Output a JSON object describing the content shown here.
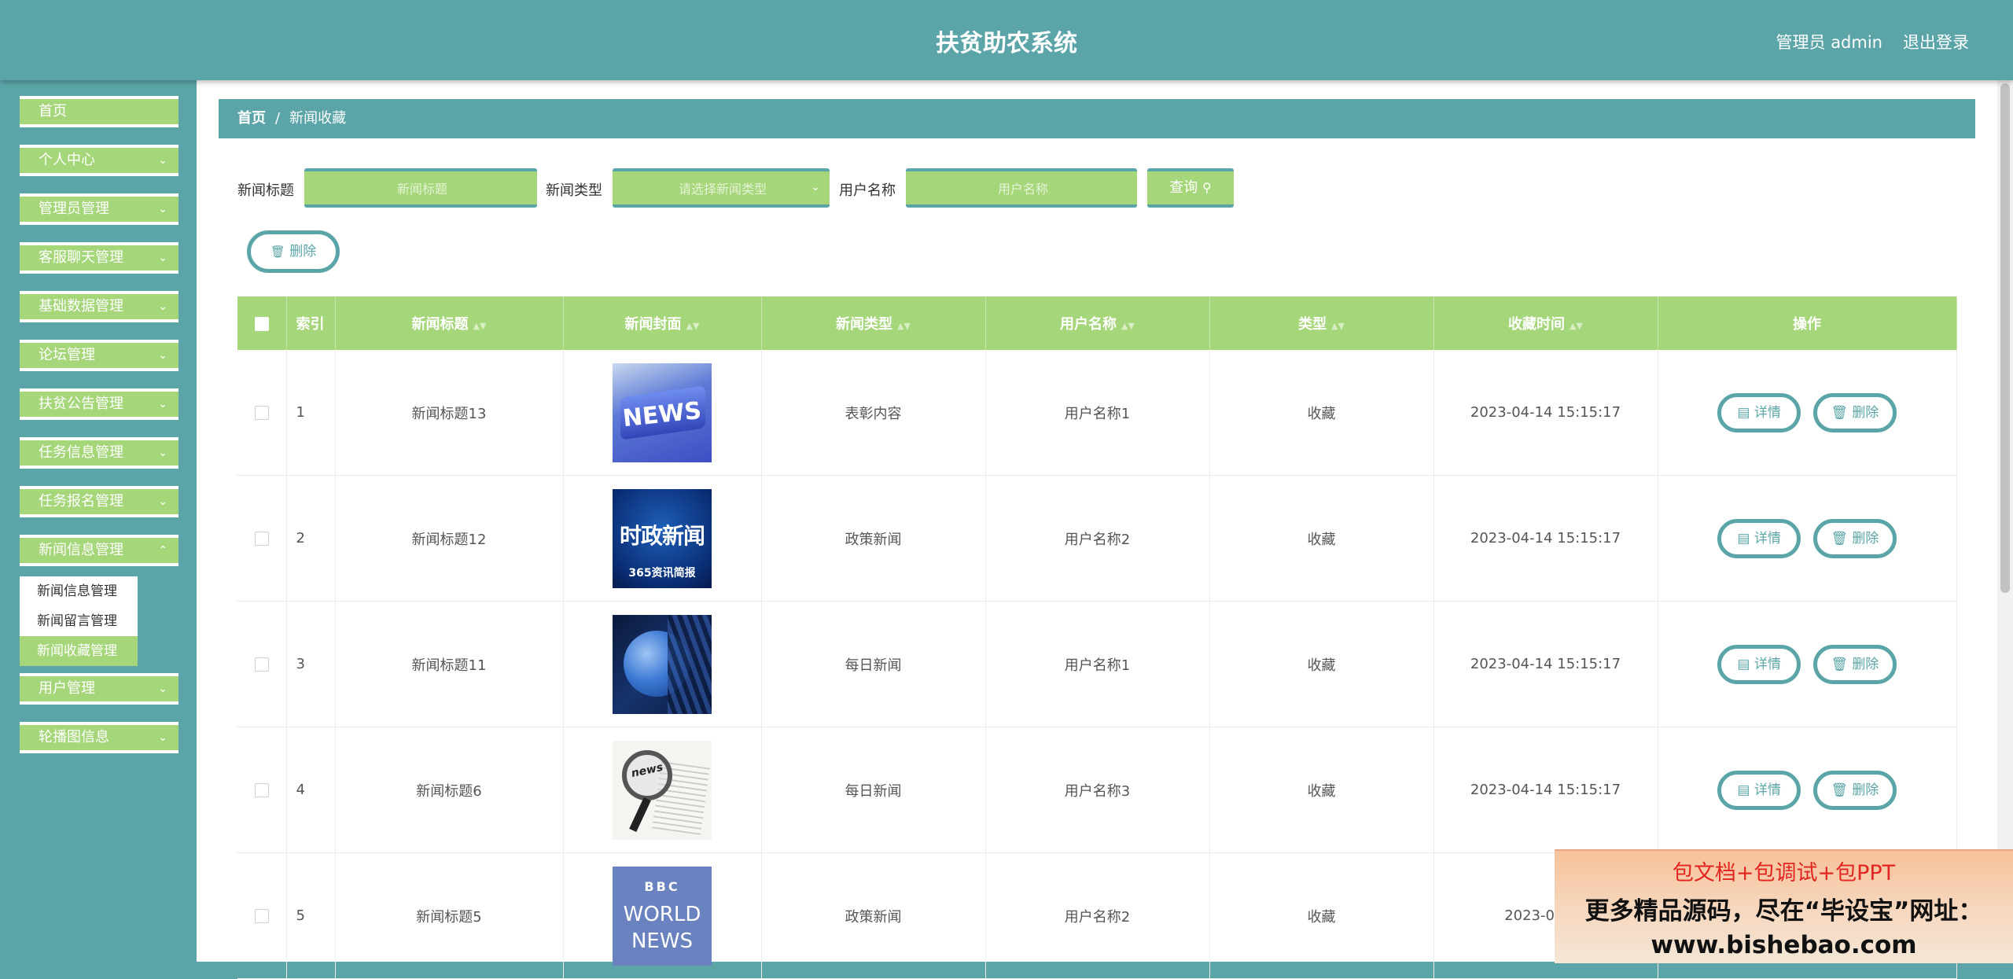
{
  "header": {
    "title": "扶贫助农系统",
    "user": "管理员 admin",
    "logout": "退出登录"
  },
  "sidebar": {
    "items": [
      {
        "label": "首页"
      },
      {
        "label": "个人中心"
      },
      {
        "label": "管理员管理"
      },
      {
        "label": "客服聊天管理"
      },
      {
        "label": "基础数据管理"
      },
      {
        "label": "论坛管理"
      },
      {
        "label": "扶贫公告管理"
      },
      {
        "label": "任务信息管理"
      },
      {
        "label": "任务报名管理"
      },
      {
        "label": "新闻信息管理"
      },
      {
        "label": "用户管理"
      },
      {
        "label": "轮播图信息"
      }
    ],
    "submenu": [
      "新闻信息管理",
      "新闻留言管理",
      "新闻收藏管理"
    ]
  },
  "breadcrumb": {
    "home": "首页",
    "separator": "/",
    "current": "新闻收藏"
  },
  "search": {
    "title_label": "新闻标题",
    "title_placeholder": "新闻标题",
    "type_label": "新闻类型",
    "type_placeholder": "请选择新闻类型",
    "user_label": "用户名称",
    "user_placeholder": "用户名称",
    "query_button": "查询"
  },
  "actions": {
    "delete_button": "删除"
  },
  "table": {
    "headers": [
      "索引",
      "新闻标题",
      "新闻封面",
      "新闻类型",
      "用户名称",
      "类型",
      "收藏时间",
      "操作"
    ],
    "detail_label": "详情",
    "delete_label": "删除",
    "rows": [
      {
        "index": "1",
        "title": "新闻标题13",
        "cover": "NEWS",
        "news_type": "表彰内容",
        "user": "用户名称1",
        "kind": "收藏",
        "time": "2023-04-14 15:15:17"
      },
      {
        "index": "2",
        "title": "新闻标题12",
        "cover": "时政新闻",
        "news_type": "政策新闻",
        "user": "用户名称2",
        "kind": "收藏",
        "time": "2023-04-14 15:15:17"
      },
      {
        "index": "3",
        "title": "新闻标题11",
        "cover": "",
        "news_type": "每日新闻",
        "user": "用户名称1",
        "kind": "收藏",
        "time": "2023-04-14 15:15:17"
      },
      {
        "index": "4",
        "title": "新闻标题6",
        "cover": "news",
        "news_type": "每日新闻",
        "user": "用户名称3",
        "kind": "收藏",
        "time": "2023-04-14 15:15:17"
      },
      {
        "index": "5",
        "title": "新闻标题5",
        "cover": "BBC WORLD NEWS",
        "news_type": "政策新闻",
        "user": "用户名称2",
        "kind": "收藏",
        "time": "2023-04-14"
      }
    ]
  },
  "cover_extra": {
    "row2_sub": "365资讯简报",
    "row5_top": "BBC",
    "row5_mid": "WORLD",
    "row5_bot": "NEWS"
  },
  "ad": {
    "line1": "包文档+包调试+包PPT",
    "line2": "更多精品源码，尽在“毕设宝”网址：",
    "line3": "www.bishebao.com"
  },
  "colors": {
    "teal": "#5ba5a8",
    "green": "#a6d67a",
    "ad_red": "#e2251f"
  }
}
